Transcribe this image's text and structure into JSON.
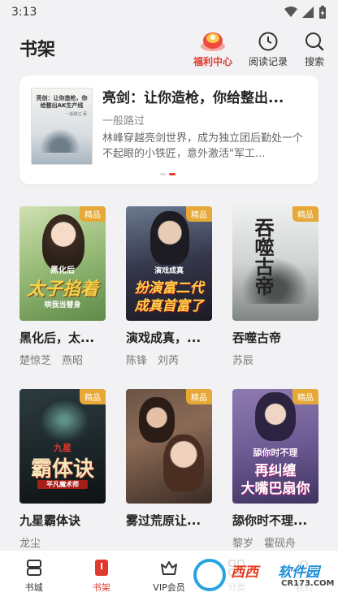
{
  "status_bar": {
    "time": "3:13"
  },
  "header": {
    "title": "书架",
    "welfare_label": "福利中心",
    "history_label": "阅读记录",
    "search_label": "搜索"
  },
  "banner": {
    "title": "亮剑：让你造枪，你给整出...",
    "author": "一般路过",
    "description": "林峰穿越亮剑世界，成为独立团后勤处一个不起眼的小铁匠，意外激活\"军工...",
    "cover_title": "亮剑：让你造枪，你给整出AK生产线",
    "cover_author": "一般路过 著"
  },
  "books": [
    {
      "name": "黑化后，太...",
      "authors": "楚惊芝　燕昭",
      "badge": "精品",
      "cover_text": "太子掐着",
      "cover_sub": "黑化后",
      "cover_sub2": "哄我当替身"
    },
    {
      "name": "演戏成真，...",
      "authors": "陈锋　刘芮",
      "badge": "精品",
      "cover_text": "扮演富二代",
      "cover_sub": "演戏成真",
      "cover_sub2": "成真首富了"
    },
    {
      "name": "吞噬古帝",
      "authors": "苏辰",
      "badge": "精品",
      "cover_text": "吞噬古帝",
      "cover_sub": "",
      "cover_sub2": ""
    },
    {
      "name": "九星霸体诀",
      "authors": "龙尘",
      "badge": "精品",
      "cover_text": "霸体诀",
      "cover_sub": "九星",
      "cover_sub2": "平凡魔术师"
    },
    {
      "name": "雾过荒原让...",
      "authors": "",
      "badge": "精品",
      "cover_text": "",
      "cover_sub": "",
      "cover_sub2": ""
    },
    {
      "name": "舔你时不理...",
      "authors": "黎岁　霍砚舟",
      "badge": "精品",
      "cover_text": "再纠缠",
      "cover_sub": "舔你时不理",
      "cover_sub2": "大嘴巴扇你"
    }
  ],
  "bottom_nav": [
    {
      "label": "书城",
      "icon": "bookstore-icon"
    },
    {
      "label": "书架",
      "icon": "bookshelf-icon"
    },
    {
      "label": "VIP会员",
      "icon": "vip-crown-icon"
    },
    {
      "label": "分类",
      "icon": "category-grid-icon"
    },
    {
      "label": "我的",
      "icon": "profile-icon"
    }
  ],
  "watermark": {
    "brand": "西西",
    "brand2": "软件园",
    "domain": "CR173.COM"
  },
  "colors": {
    "accent": "#e03a2e",
    "badge": "#e6a937"
  }
}
